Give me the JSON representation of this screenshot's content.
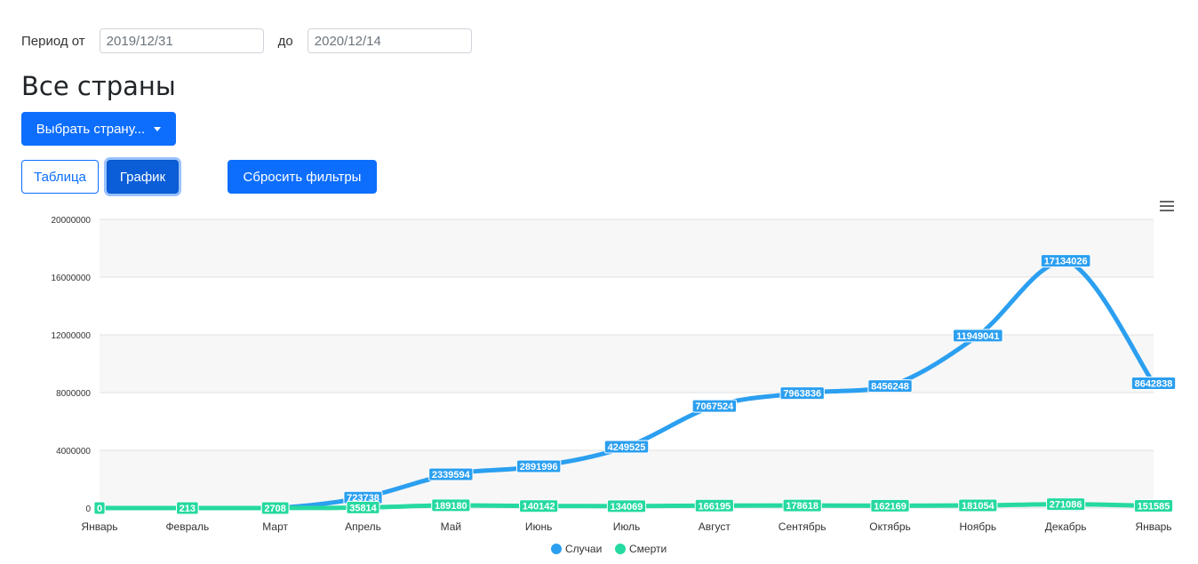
{
  "filters": {
    "period_from_label": "Период от",
    "date_from": "2019/12/31",
    "to_label": "до",
    "date_to": "2020/12/14"
  },
  "page_title": "Все страны",
  "buttons": {
    "select_country": "Выбрать страну...",
    "table": "Таблица",
    "chart": "График",
    "reset": "Сбросить фильтры"
  },
  "colors": {
    "cases": "#2b9ff0",
    "deaths": "#26d9a0",
    "primary": "#0d6efd"
  },
  "icons": {
    "menu": "hamburger-menu-icon"
  },
  "chart_data": {
    "type": "line",
    "categories": [
      "Январь",
      "Февраль",
      "Март",
      "Апрель",
      "Май",
      "Июнь",
      "Июль",
      "Август",
      "Сентябрь",
      "Октябрь",
      "Ноябрь",
      "Декабрь",
      "Январь"
    ],
    "series": [
      {
        "name": "Случаи",
        "values": [
          0,
          213,
          2708,
          723738,
          2339594,
          2891996,
          4249525,
          7067524,
          7963836,
          8456248,
          11949041,
          17134026,
          8642838
        ]
      },
      {
        "name": "Смерти",
        "values": [
          0,
          213,
          2708,
          35814,
          189180,
          140142,
          134069,
          166195,
          178618,
          162169,
          181054,
          271086,
          151585
        ]
      }
    ],
    "y_ticks": [
      "0",
      "4000000",
      "8000000",
      "12000000",
      "16000000",
      "20000000"
    ],
    "ylim": [
      0,
      20000000
    ],
    "grid": true,
    "legend_position": "bottom-center"
  }
}
